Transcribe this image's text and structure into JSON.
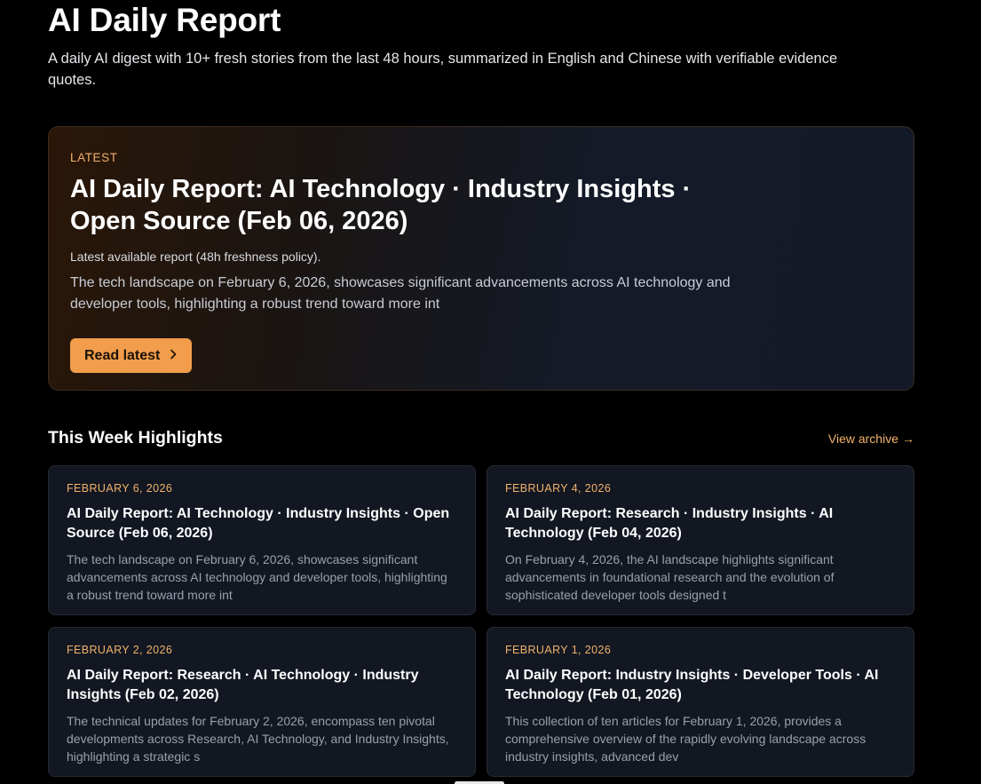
{
  "site": {
    "title": "AI Daily Report",
    "subtitle": "A daily AI digest with 10+ fresh stories from the last 48 hours, summarized in English and Chinese with verifiable evidence quotes."
  },
  "hero": {
    "eyebrow": "LATEST",
    "title": "AI Daily Report: AI Technology · Industry Insights · Open Source (Feb 06, 2026)",
    "note": "Latest available report (48h freshness policy).",
    "summary": "The tech landscape on February 6, 2026, showcases significant advancements across AI technology and developer tools, highlighting a robust trend toward more int",
    "button_label": "Read latest",
    "button_icon": "chevron-right-icon"
  },
  "highlights": {
    "title": "This Week Highlights",
    "archive_label": "View archive",
    "archive_arrow": "→",
    "cards": [
      {
        "date": "FEBRUARY 6, 2026",
        "title": "AI Daily Report: AI Technology · Industry Insights · Open Source (Feb 06, 2026)",
        "summary": "The tech landscape on February 6, 2026, showcases significant advancements across AI technology and developer tools, highlighting a robust trend toward more int"
      },
      {
        "date": "FEBRUARY 4, 2026",
        "title": "AI Daily Report: Research · Industry Insights · AI Technology (Feb 04, 2026)",
        "summary": "On February 4, 2026, the AI landscape highlights significant advancements in foundational research and the evolution of sophisticated developer tools designed t"
      },
      {
        "date": "FEBRUARY 2, 2026",
        "title": "AI Daily Report: Research · AI Technology · Industry Insights (Feb 02, 2026)",
        "summary": "The technical updates for February 2, 2026, encompass ten pivotal developments across Research, AI Technology, and Industry Insights, highlighting a strategic s"
      },
      {
        "date": "FEBRUARY 1, 2026",
        "title": "AI Daily Report: Industry Insights · Developer Tools · AI Technology (Feb 01, 2026)",
        "summary": "This collection of ten articles for February 1, 2026, provides a comprehensive overview of the rapidly evolving landscape across industry insights, advanced dev"
      }
    ]
  },
  "colors": {
    "background": "#000000",
    "accent": "#f19d4b",
    "accent_text": "#f2b26a",
    "card_background": "#121722"
  }
}
